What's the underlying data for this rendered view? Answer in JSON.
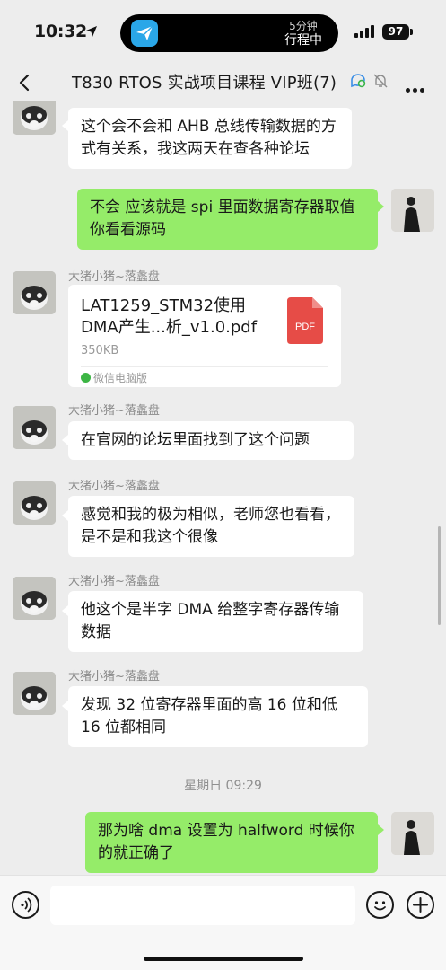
{
  "status_bar": {
    "time": "10:32",
    "island_line1": "5分钟",
    "island_line2": "行程中",
    "battery": "97"
  },
  "nav": {
    "title": "T830 RTOS 实战项目课程 VIP班(7)"
  },
  "messages": [
    {
      "text": "这个会不会和 AHB 总线传输数据的方式有关系，我这两天在查各种论坛"
    },
    {
      "text": "不会 应该就是 spi 里面数据寄存器取值 你看看源码"
    },
    {
      "sender": "大猪小猪~落촉盘"
    },
    {
      "sender": "大猪小猪~落촉盘",
      "text": "在官网的论坛里面找到了这个问题"
    },
    {
      "sender": "大猪小猪~落촉盘",
      "text": "感觉和我的极为相似，老师您也看看，是不是和我这个很像"
    },
    {
      "sender": "大猪小猪~落촉盘",
      "text": "他这个是半字 DMA 给整字寄存器传输数据"
    },
    {
      "sender": "大猪小猪~落촉盘",
      "text": "发现 32 位寄存器里面的高 16 位和低 16 位都相同"
    },
    {
      "text": "那为啥 dma 设置为 halfword 时候你的就正确了"
    }
  ],
  "file": {
    "name": "LAT1259_STM32使用DMA产生...析_v1.0.pdf",
    "size": "350KB",
    "icon_label": "PDF",
    "source": "微信电脑版"
  },
  "timestamp": "星期日 09:29",
  "colors": {
    "my_bubble": "#95ec69",
    "their_bubble": "#ffffff",
    "background": "#ededed",
    "pdf_red": "#e64c47"
  }
}
